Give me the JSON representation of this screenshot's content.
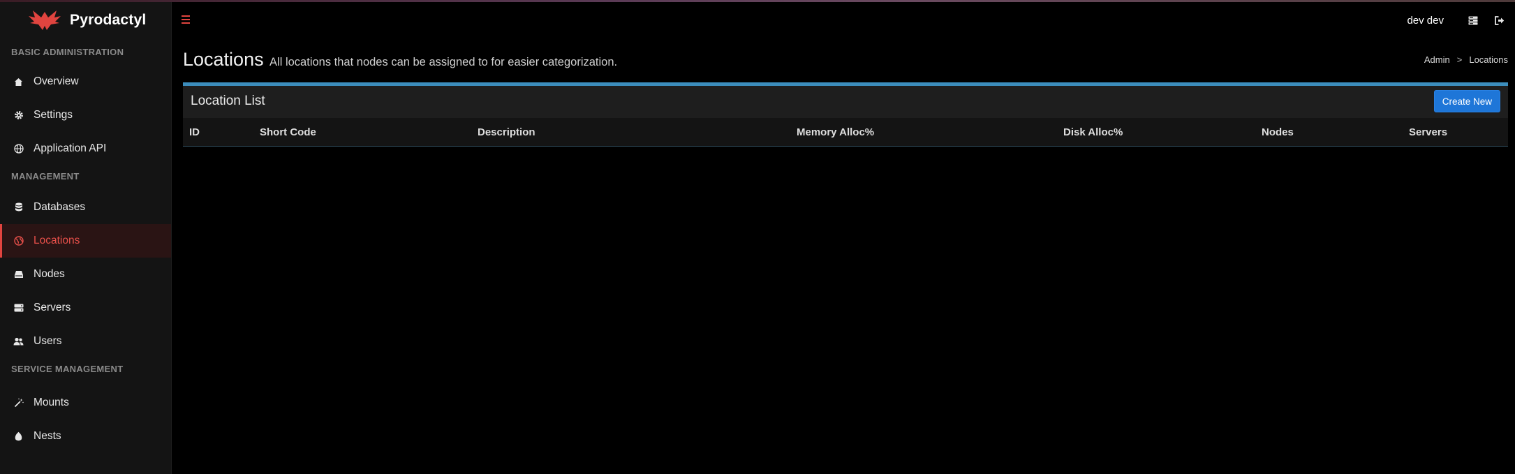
{
  "brand": {
    "name": "Pyrodactyl",
    "accent": "#e0443f"
  },
  "sidebar": {
    "sections": [
      {
        "header": "BASIC ADMINISTRATION",
        "items": [
          {
            "label": "Overview",
            "icon": "home-icon"
          },
          {
            "label": "Settings",
            "icon": "gear-icon"
          },
          {
            "label": "Application API",
            "icon": "globe-icon"
          }
        ]
      },
      {
        "header": "MANAGEMENT",
        "items": [
          {
            "label": "Databases",
            "icon": "database-icon"
          },
          {
            "label": "Locations",
            "icon": "globe-icon",
            "active": true
          },
          {
            "label": "Nodes",
            "icon": "node-icon"
          },
          {
            "label": "Servers",
            "icon": "server-icon"
          },
          {
            "label": "Users",
            "icon": "users-icon"
          }
        ]
      },
      {
        "header": "SERVICE MANAGEMENT",
        "items": [
          {
            "label": "Mounts",
            "icon": "magic-wand-icon"
          },
          {
            "label": "Nests",
            "icon": "egg-icon"
          }
        ]
      }
    ]
  },
  "topbar": {
    "menu_icon": "hamburger-icon",
    "user": "dev dev",
    "icons": [
      "server-list-icon",
      "sign-out-icon"
    ]
  },
  "header": {
    "title": "Locations",
    "subtitle": "All locations that nodes can be assigned to for easier categorization.",
    "breadcrumb": [
      "Admin",
      "Locations"
    ],
    "breadcrumb_sep": ">"
  },
  "box": {
    "title": "Location List",
    "create_label": "Create New",
    "columns": [
      "ID",
      "Short Code",
      "Description",
      "Memory Alloc%",
      "Disk Alloc%",
      "Nodes",
      "Servers"
    ],
    "rows": []
  }
}
